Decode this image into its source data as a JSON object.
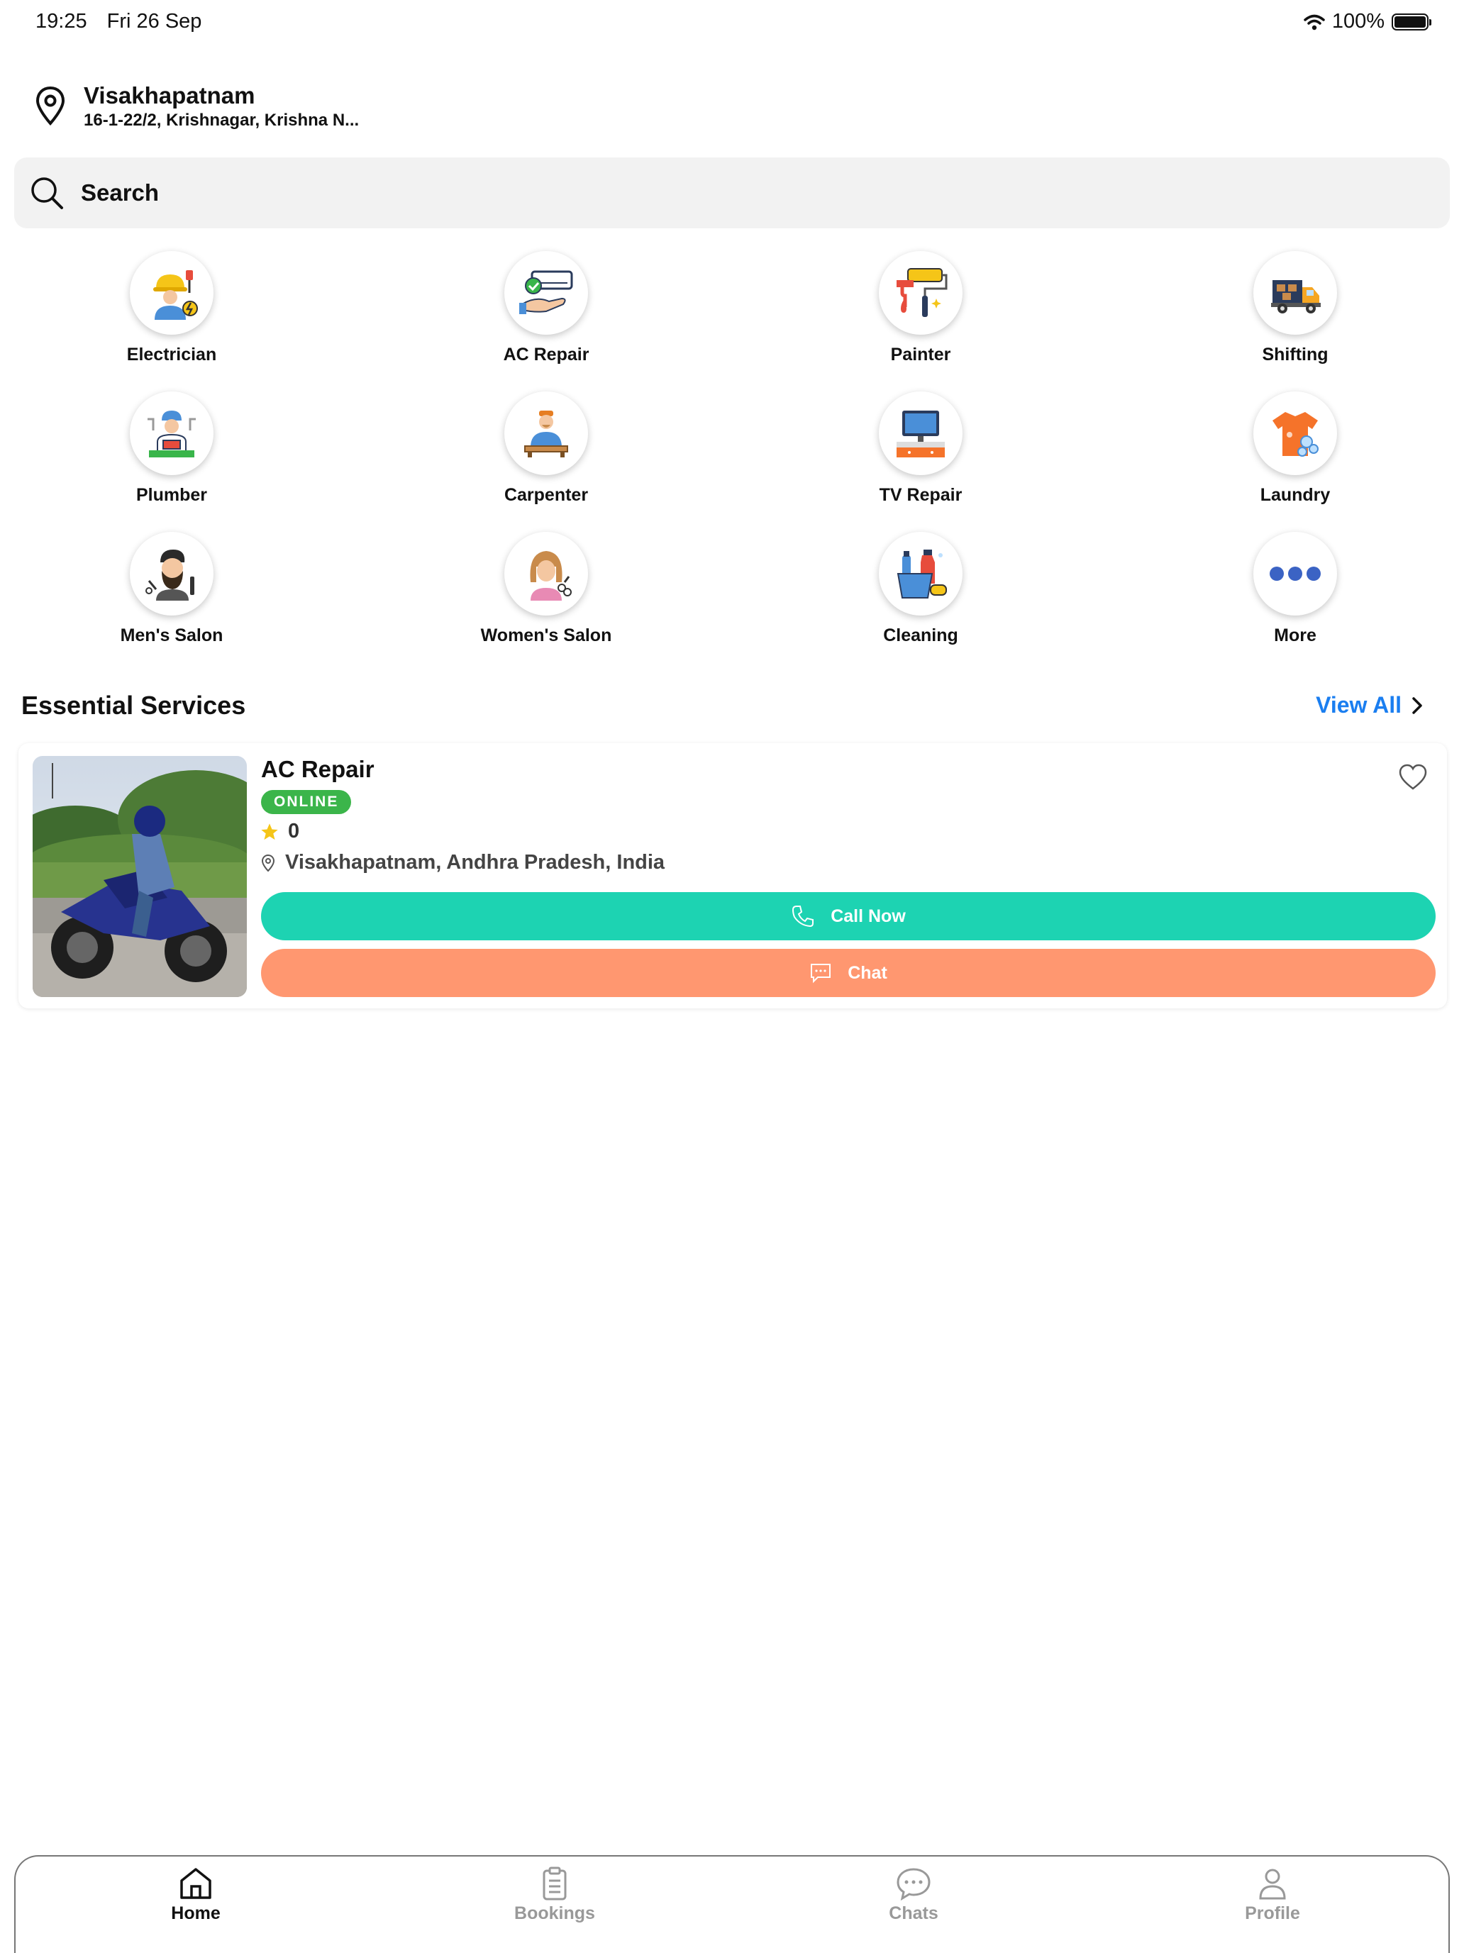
{
  "status_bar": {
    "time": "19:25",
    "date": "Fri 26 Sep",
    "battery": "100%"
  },
  "location": {
    "city": "Visakhapatnam",
    "address": "16-1-22/2, Krishnagar, Krishna N..."
  },
  "search": {
    "placeholder": "Search"
  },
  "categories": [
    {
      "label": "Electrician",
      "icon": "electrician-icon"
    },
    {
      "label": "AC Repair",
      "icon": "ac-repair-icon"
    },
    {
      "label": "Painter",
      "icon": "painter-icon"
    },
    {
      "label": "Shifting",
      "icon": "shifting-truck-icon"
    },
    {
      "label": "Plumber",
      "icon": "plumber-icon"
    },
    {
      "label": "Carpenter",
      "icon": "carpenter-icon"
    },
    {
      "label": "TV Repair",
      "icon": "tv-repair-icon"
    },
    {
      "label": "Laundry",
      "icon": "laundry-icon"
    },
    {
      "label": "Men's Salon",
      "icon": "mens-salon-icon"
    },
    {
      "label": "Women's Salon",
      "icon": "womens-salon-icon"
    },
    {
      "label": "Cleaning",
      "icon": "cleaning-icon"
    },
    {
      "label": "More",
      "icon": "more-dots-icon"
    }
  ],
  "essential": {
    "title": "Essential Services",
    "view_all": "View All",
    "card": {
      "title": "AC Repair",
      "status": "ONLINE",
      "rating": "0",
      "location": "Visakhapatnam, Andhra Pradesh, India",
      "call_label": "Call Now",
      "chat_label": "Chat"
    }
  },
  "tabs": [
    {
      "label": "Home",
      "icon": "home-icon",
      "active": true
    },
    {
      "label": "Bookings",
      "icon": "clipboard-icon",
      "active": false
    },
    {
      "label": "Chats",
      "icon": "chat-bubble-icon",
      "active": false
    },
    {
      "label": "Profile",
      "icon": "person-icon",
      "active": false
    }
  ],
  "colors": {
    "accent_blue": "#1a7ef0",
    "online_green": "#3bb54a",
    "call_teal": "#1dd3b2",
    "chat_orange": "#ff9770"
  }
}
